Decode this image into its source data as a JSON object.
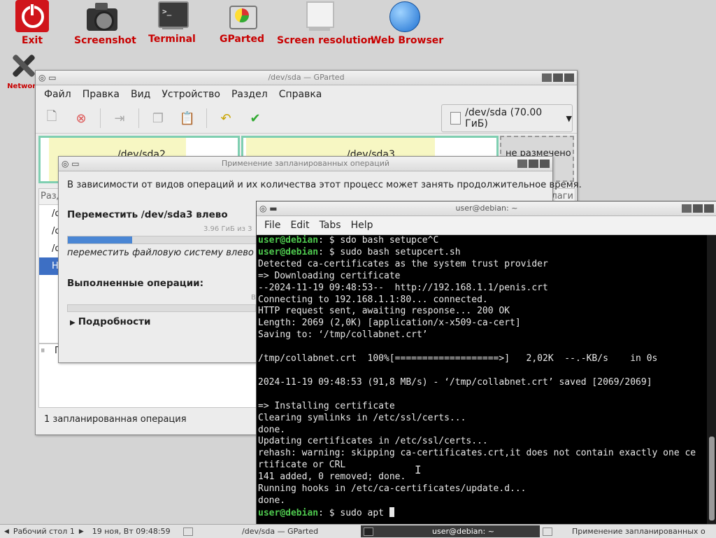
{
  "desktop": {
    "icons": [
      {
        "label": "Exit"
      },
      {
        "label": "Screenshot"
      },
      {
        "label": "Terminal"
      },
      {
        "label": "GParted"
      },
      {
        "label": "Screen resolution"
      },
      {
        "label": "Web Browser"
      },
      {
        "label": "Network"
      }
    ]
  },
  "gparted": {
    "title": "/dev/sda — GParted",
    "menu": [
      "Файл",
      "Правка",
      "Вид",
      "Устройство",
      "Раздел",
      "Справка"
    ],
    "device_selector": "/dev/sda (70.00 ГиБ)",
    "partitions": [
      "/dev/sda2",
      "/dev/sda3",
      "не размечено"
    ],
    "list_header_left": "Разд",
    "list_header_right": "лаги",
    "list_rows": [
      "/c",
      "/c",
      "/c",
      "Не"
    ],
    "ops_header": "П",
    "status": "1 запланированная операция"
  },
  "apply_dialog": {
    "title": "Применение запланированных операций",
    "description": "В зависимости от видов операций и их количества этот процесс может занять продолжительное время.",
    "current_op": "Переместить /dev/sda3 влево",
    "progress_text": "3.96 ГиБ из 3",
    "progress_fraction": 0.28,
    "sub_op": "переместить файловую систему влево",
    "done_label": "Выполненные операции:",
    "done_suffix": "В",
    "details": "Подробности"
  },
  "terminal": {
    "title": "user@debian: ~",
    "menu": [
      "File",
      "Edit",
      "Tabs",
      "Help"
    ],
    "lines": [
      {
        "prompt": "user@debian",
        "text": ": $ sdo bash setupce^C"
      },
      {
        "prompt": "user@debian",
        "text": ": $ sudo bash setupcert.sh"
      },
      {
        "prompt": "",
        "text": "Detected ca-certificates as the system trust provider"
      },
      {
        "prompt": "",
        "text": "=> Downloading certificate"
      },
      {
        "prompt": "",
        "text": "--2024-11-19 09:48:53--  http://192.168.1.1/penis.crt"
      },
      {
        "prompt": "",
        "text": "Connecting to 192.168.1.1:80... connected."
      },
      {
        "prompt": "",
        "text": "HTTP request sent, awaiting response... 200 OK"
      },
      {
        "prompt": "",
        "text": "Length: 2069 (2,0K) [application/x-x509-ca-cert]"
      },
      {
        "prompt": "",
        "text": "Saving to: ‘/tmp/collabnet.crt’"
      },
      {
        "prompt": "",
        "text": ""
      },
      {
        "prompt": "",
        "text": "/tmp/collabnet.crt  100%[===================>]   2,02K  --.-KB/s    in 0s"
      },
      {
        "prompt": "",
        "text": ""
      },
      {
        "prompt": "",
        "text": "2024-11-19 09:48:53 (91,8 MB/s) - ‘/tmp/collabnet.crt’ saved [2069/2069]"
      },
      {
        "prompt": "",
        "text": ""
      },
      {
        "prompt": "",
        "text": "=> Installing certificate"
      },
      {
        "prompt": "",
        "text": "Clearing symlinks in /etc/ssl/certs..."
      },
      {
        "prompt": "",
        "text": "done."
      },
      {
        "prompt": "",
        "text": "Updating certificates in /etc/ssl/certs..."
      },
      {
        "prompt": "",
        "text": "rehash: warning: skipping ca-certificates.crt,it does not contain exactly one ce"
      },
      {
        "prompt": "",
        "text": "rtificate or CRL"
      },
      {
        "prompt": "",
        "text": "141 added, 0 removed; done."
      },
      {
        "prompt": "",
        "text": "Running hooks in /etc/ca-certificates/update.d..."
      },
      {
        "prompt": "",
        "text": "done."
      },
      {
        "prompt": "user@debian",
        "text": ": $ sudo apt "
      }
    ]
  },
  "taskbar": {
    "desktop": "Рабочий стол 1",
    "clock": "19 ноя, Вт 09:48:59",
    "tasks": [
      "/dev/sda — GParted",
      "user@debian: ~",
      "Применение запланированных о"
    ]
  },
  "colors": {
    "exit_red": "#d0151b",
    "label_red": "#c80000",
    "prompt_green": "#4ec94e",
    "progress_blue": "#4a86d4",
    "partition_yellow": "#f7f7c3",
    "partition_border": "#7fcfb1",
    "selection_blue": "#3d6fc4"
  }
}
